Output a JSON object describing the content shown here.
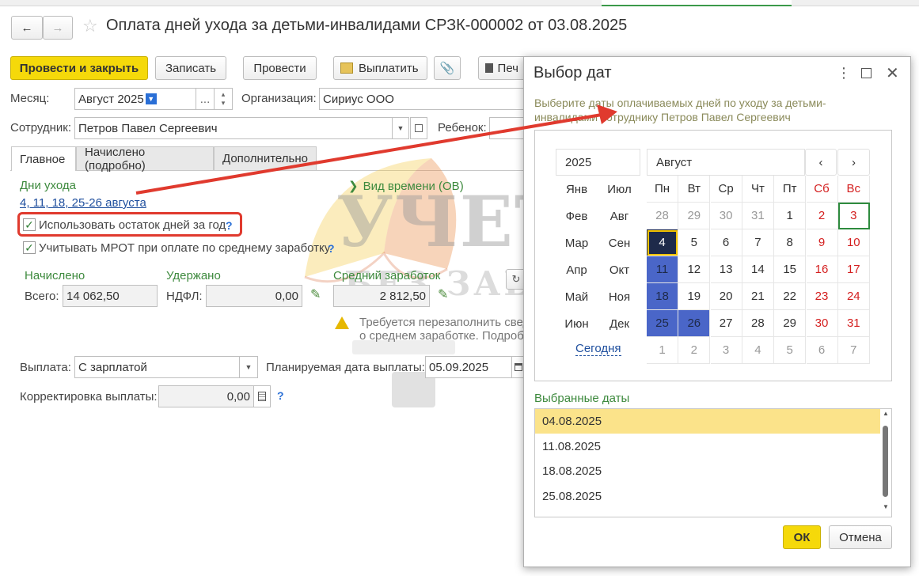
{
  "window": {
    "title": "Оплата дней ухода за детьми-инвалидами СРЗК-000002 от 03.08.2025"
  },
  "toolbar": {
    "post_close": "Провести и закрыть",
    "save": "Записать",
    "post": "Провести",
    "pay": "Выплатить",
    "print": "Печ"
  },
  "form": {
    "month_label": "Месяц:",
    "month_value": "Август 2025",
    "month_dots": "...",
    "org_label": "Организация:",
    "org_value": "Сириус ООО",
    "employee_label": "Сотрудник:",
    "employee_value": "Петров Павел Сергеевич",
    "child_label": "Ребенок:"
  },
  "tabs": [
    "Главное",
    "Начислено (подробно)",
    "Дополнительно"
  ],
  "main": {
    "care_days_label": "Дни ухода",
    "care_days_value": "4, 11, 18, 25-26 августа",
    "time_type": "Вид времени (ОВ)",
    "use_rest_label": "Использовать остаток дней за год",
    "mrot_label": "Учитывать МРОТ при оплате по среднему заработку",
    "help": "?",
    "accrued_label": "Начислено",
    "withheld_label": "Удержано",
    "avg_label": "Средний заработок",
    "total_label": "Всего:",
    "total_value": "14 062,50",
    "ndfl_label": "НДФЛ:",
    "ndfl_value": "0,00",
    "avg_value": "2 812,50",
    "warning_line1": "Требуется перезаполнить свед",
    "warning_line2": "о среднем заработке. Подробн",
    "payment_label": "Выплата:",
    "payment_value": "С зарплатой",
    "plan_date_label": "Планируемая дата выплаты:",
    "plan_date_value": "05.09.2025",
    "correction_label": "Корректировка выплаты:",
    "correction_value": "0,00"
  },
  "watermark": {
    "line1": "УЧЕТ",
    "line2": "БЕЗ ЗАБОТ"
  },
  "dialog": {
    "title": "Выбор дат",
    "hint_line1": "Выберите даты оплачиваемых дней по уходу за детьми-",
    "hint_line2": "инвалидами сотруднику Петров Павел Сергеевич",
    "year": "2025",
    "month": "Август",
    "months_col1": [
      "Янв",
      "Фев",
      "Мар",
      "Апр",
      "Май",
      "Июн"
    ],
    "months_col2": [
      "Июл",
      "Авг",
      "Сен",
      "Окт",
      "Ноя",
      "Дек"
    ],
    "today": "Сегодня",
    "weekdays": [
      "Пн",
      "Вт",
      "Ср",
      "Чт",
      "Пт",
      "Сб",
      "Вс"
    ],
    "weeks": [
      [
        "28",
        "29",
        "30",
        "31",
        "1",
        "2",
        "3"
      ],
      [
        "4",
        "5",
        "6",
        "7",
        "8",
        "9",
        "10"
      ],
      [
        "11",
        "12",
        "13",
        "14",
        "15",
        "16",
        "17"
      ],
      [
        "18",
        "19",
        "20",
        "21",
        "22",
        "23",
        "24"
      ],
      [
        "25",
        "26",
        "27",
        "28",
        "29",
        "30",
        "31"
      ],
      [
        "1",
        "2",
        "3",
        "4",
        "5",
        "6",
        "7"
      ]
    ],
    "selected_label": "Выбранные даты",
    "selected_dates": [
      "04.08.2025",
      "11.08.2025",
      "18.08.2025",
      "25.08.2025"
    ],
    "ok": "ОК",
    "cancel": "Отмена"
  },
  "colors": {
    "accent_yellow": "#f5d90a",
    "selected_blue": "#4a66c8",
    "focused_dark": "#1e2a4a",
    "weekend_red": "#d42020",
    "green_text": "#3e8a3e",
    "annotation_red": "#e03a2e"
  }
}
